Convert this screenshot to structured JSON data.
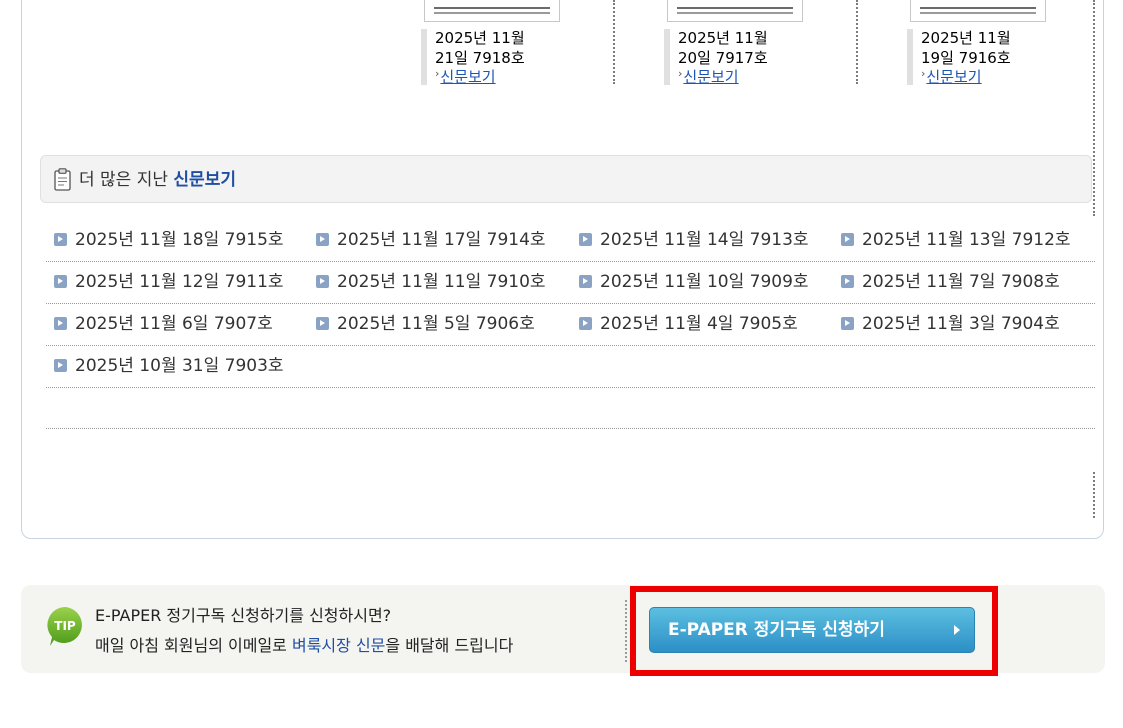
{
  "recent_issues": [
    {
      "date": "2025년 11월\n21일 7918호",
      "link": "신문보기"
    },
    {
      "date": "2025년 11월\n20일 7917호",
      "link": "신문보기"
    },
    {
      "date": "2025년 11월\n19일 7916호",
      "link": "신문보기"
    }
  ],
  "more_section": {
    "prefix": "더 많은 지난 ",
    "accent": "신문보기",
    "icon": "clipboard-icon"
  },
  "past_issues": [
    [
      "2025년 11월 18일 7915호",
      "2025년 11월 17일 7914호",
      "2025년 11월 14일 7913호",
      "2025년 11월 13일 7912호"
    ],
    [
      "2025년 11월 12일 7911호",
      "2025년 11월 11일 7910호",
      "2025년 11월 10일 7909호",
      "2025년 11월 7일 7908호"
    ],
    [
      "2025년 11월 6일 7907호",
      "2025년 11월 5일 7906호",
      "2025년 11월 4일 7905호",
      "2025년 11월 3일 7904호"
    ],
    [
      "2025년 10월 31일 7903호"
    ]
  ],
  "tip": {
    "badge": "TIP",
    "line1": "E-PAPER 정기구독 신청하기를 신청하시면?",
    "line2_pre": "매일 아침 회원님의 이메일로 ",
    "line2_accent": "벼룩시장 신문",
    "line2_post": "을 배달해 드립니다",
    "button_label": "E-PAPER 정기구독 신청하기"
  },
  "colors": {
    "link": "#1c56b5",
    "accent": "#1f4fa3",
    "button": "#3aa3d4",
    "highlight": "#ee0000"
  }
}
